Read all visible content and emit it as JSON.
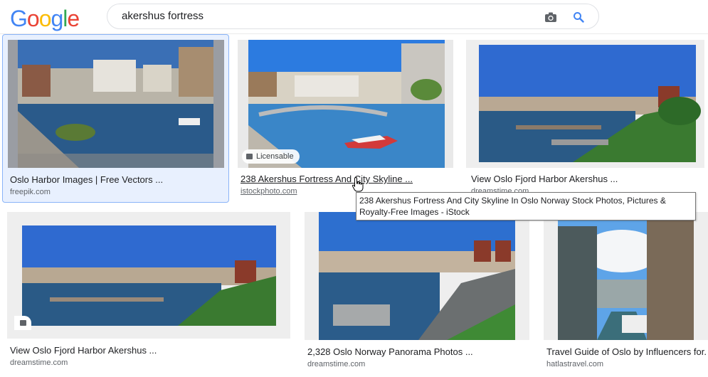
{
  "logo": {
    "letters": [
      "G",
      "o",
      "o",
      "g",
      "l",
      "e"
    ],
    "colors": [
      "#4285F4",
      "#EA4335",
      "#FBBC05",
      "#4285F4",
      "#34A853",
      "#EA4335"
    ]
  },
  "search": {
    "query": "akershus fortress",
    "camera_icon": "camera-icon",
    "search_icon": "magnifier-icon"
  },
  "results": [
    {
      "title": "Oslo Harbor Images | Free Vectors ...",
      "domain": "freepik.com"
    },
    {
      "title": "238 Akershus Fortress And City Skyline ...",
      "domain": "istockphoto.com",
      "badge": "Licensable"
    },
    {
      "title": "View Oslo Fjord Harbor Akershus ...",
      "domain": "dreamstime.com"
    },
    {
      "title": "View Oslo Fjord Harbor Akershus ...",
      "domain": "dreamstime.com"
    },
    {
      "title": "2,328 Oslo Norway Panorama Photos ...",
      "domain": "dreamstime.com"
    },
    {
      "title": "Travel Guide of Oslo by Influencers for...",
      "domain": "hatlastravel.com"
    }
  ],
  "tooltip": "238 Akershus Fortress And City Skyline In Oslo Norway Stock Photos,  Pictures & Royalty-Free Images - iStock",
  "colors": {
    "accent": "#1a73e8",
    "selected_bg": "#e8f0fe",
    "sky": "#2f6fc4",
    "water": "#1d4e89"
  }
}
